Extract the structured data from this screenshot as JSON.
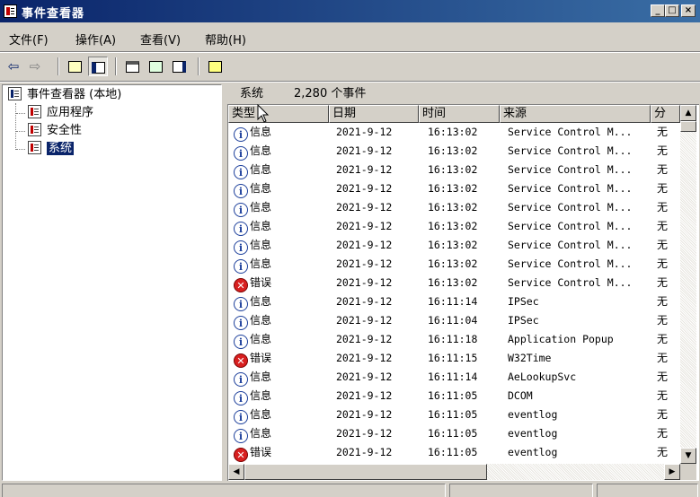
{
  "window": {
    "title": "事件查看器",
    "min_glyph": "_",
    "max_glyph": "□",
    "close_glyph": "×"
  },
  "menu": [
    {
      "label": "文件(F)"
    },
    {
      "label": "操作(A)"
    },
    {
      "label": "查看(V)"
    },
    {
      "label": "帮助(H)"
    }
  ],
  "toolbar": {
    "back_glyph": "⇦",
    "forward_glyph": "⇨"
  },
  "tree": {
    "root": "事件查看器 (本地)",
    "items": [
      {
        "label": "应用程序",
        "selected": false
      },
      {
        "label": "安全性",
        "selected": false
      },
      {
        "label": "系统",
        "selected": true
      }
    ]
  },
  "pane": {
    "title": "系统",
    "count": "2,280 个事件"
  },
  "columns": [
    {
      "label": "类型"
    },
    {
      "label": "日期"
    },
    {
      "label": "时间"
    },
    {
      "label": "来源"
    },
    {
      "label": "分"
    }
  ],
  "rows": [
    {
      "type": "信息",
      "kind": "info",
      "date": "2021-9-12",
      "time": "16:13:02",
      "source": "Service Control M...",
      "cat": "无"
    },
    {
      "type": "信息",
      "kind": "info",
      "date": "2021-9-12",
      "time": "16:13:02",
      "source": "Service Control M...",
      "cat": "无"
    },
    {
      "type": "信息",
      "kind": "info",
      "date": "2021-9-12",
      "time": "16:13:02",
      "source": "Service Control M...",
      "cat": "无"
    },
    {
      "type": "信息",
      "kind": "info",
      "date": "2021-9-12",
      "time": "16:13:02",
      "source": "Service Control M...",
      "cat": "无"
    },
    {
      "type": "信息",
      "kind": "info",
      "date": "2021-9-12",
      "time": "16:13:02",
      "source": "Service Control M...",
      "cat": "无"
    },
    {
      "type": "信息",
      "kind": "info",
      "date": "2021-9-12",
      "time": "16:13:02",
      "source": "Service Control M...",
      "cat": "无"
    },
    {
      "type": "信息",
      "kind": "info",
      "date": "2021-9-12",
      "time": "16:13:02",
      "source": "Service Control M...",
      "cat": "无"
    },
    {
      "type": "信息",
      "kind": "info",
      "date": "2021-9-12",
      "time": "16:13:02",
      "source": "Service Control M...",
      "cat": "无"
    },
    {
      "type": "错误",
      "kind": "error",
      "date": "2021-9-12",
      "time": "16:13:02",
      "source": "Service Control M...",
      "cat": "无"
    },
    {
      "type": "信息",
      "kind": "info",
      "date": "2021-9-12",
      "time": "16:11:14",
      "source": "IPSec",
      "cat": "无"
    },
    {
      "type": "信息",
      "kind": "info",
      "date": "2021-9-12",
      "time": "16:11:04",
      "source": "IPSec",
      "cat": "无"
    },
    {
      "type": "信息",
      "kind": "info",
      "date": "2021-9-12",
      "time": "16:11:18",
      "source": "Application Popup",
      "cat": "无"
    },
    {
      "type": "错误",
      "kind": "error",
      "date": "2021-9-12",
      "time": "16:11:15",
      "source": "W32Time",
      "cat": "无"
    },
    {
      "type": "信息",
      "kind": "info",
      "date": "2021-9-12",
      "time": "16:11:14",
      "source": "AeLookupSvc",
      "cat": "无"
    },
    {
      "type": "信息",
      "kind": "info",
      "date": "2021-9-12",
      "time": "16:11:05",
      "source": "DCOM",
      "cat": "无"
    },
    {
      "type": "信息",
      "kind": "info",
      "date": "2021-9-12",
      "time": "16:11:05",
      "source": "eventlog",
      "cat": "无"
    },
    {
      "type": "信息",
      "kind": "info",
      "date": "2021-9-12",
      "time": "16:11:05",
      "source": "eventlog",
      "cat": "无"
    },
    {
      "type": "错误",
      "kind": "error",
      "date": "2021-9-12",
      "time": "16:11:05",
      "source": "eventlog",
      "cat": "无"
    }
  ]
}
